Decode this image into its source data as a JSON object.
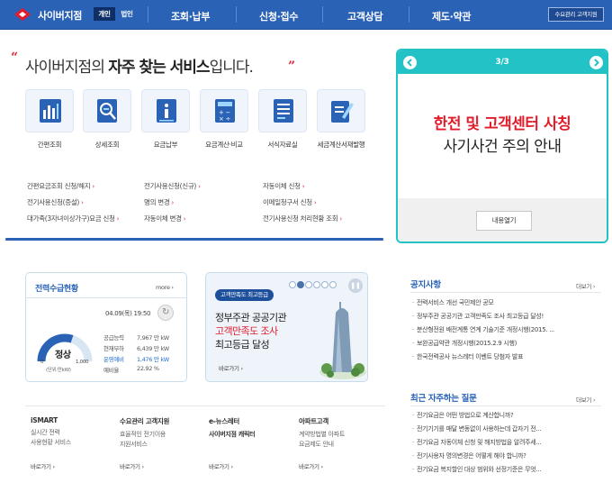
{
  "header": {
    "brand": "사이버지점",
    "segments": [
      "개인",
      "법인"
    ],
    "nav": [
      "조회·납부",
      "신청·접수",
      "고객상담",
      "제도·약관"
    ],
    "demand_button": "수요관리 고객지원"
  },
  "hero": {
    "prefix": "사이버지점의 ",
    "bold": "자주 찾는 서비스",
    "suffix": "입니다."
  },
  "services": [
    {
      "label": "간편조회",
      "icon": "bar-chart-icon"
    },
    {
      "label": "상세조회",
      "icon": "magnify-document-icon"
    },
    {
      "label": "요금납부",
      "icon": "info-card-icon"
    },
    {
      "label": "요금계산·비교",
      "icon": "calculator-icon"
    },
    {
      "label": "서식자료실",
      "icon": "form-list-icon"
    },
    {
      "label": "세금계산서재발행",
      "icon": "pencil-document-icon"
    }
  ],
  "quick_links": [
    [
      "간편요금조회 신청/해지",
      "전기사용신청(신규)",
      "자동이체 신청"
    ],
    [
      "전기사용신청(증설)",
      "명의 변경",
      "이메일청구서 신청"
    ],
    [
      "대가족(3자녀이상가구)요금 신청",
      "자동이체 변경",
      "전기사용신청 처리현황 조회"
    ]
  ],
  "notice": {
    "page": "3/3",
    "line1": "한전 및 고객센터 사칭",
    "line2": "사기사건 주의 안내",
    "button": "내용열기"
  },
  "power": {
    "title": "전력수급현황",
    "more": "more",
    "datetime": "04.09(목) 19:50",
    "state": "정상",
    "scale_min": "0",
    "scale_max": "1,000",
    "unit": "(단위:만kW)",
    "gauge_fraction": 0.6,
    "stats": [
      {
        "k": "공급능력",
        "v": "7,967 만 kW",
        "hl": false
      },
      {
        "k": "현재부하",
        "v": "6,439 만 kW",
        "hl": false
      },
      {
        "k": "운영예비",
        "v": "1,476 만 kW",
        "hl": true
      },
      {
        "k": "예비율",
        "v": "22.92 %",
        "hl": false
      }
    ]
  },
  "promo": {
    "badge": "고객만족도 최고등급",
    "line1": "정부주관 공공기관",
    "line2": "고객만족도 조사",
    "line3": "최고등급 달성",
    "more": "바로가기",
    "dots_total": 6,
    "dots_active": 1
  },
  "announcements": {
    "title": "공지사항",
    "more": "더보기",
    "items": [
      "전력서비스 개선 국민제안 공모",
      "정부주관 공공기관 고객만족도 조사 최고등급 달성!",
      "분산형전원 배전계통 연계 기술기준 개정시행(2015. ...",
      "보완공급약관 개정시행(2015.2.9 시행)",
      "한국전력공사 뉴스레터 이벤트 당첨자 발표"
    ]
  },
  "faq": {
    "title": "최근 자주하는 질문",
    "more": "더보기",
    "items": [
      "전기요금은 어떤 방법으로 계산합니까?",
      "전기기기를 매달 변동없이 사용하는데 갑자기 전...",
      "전기요금 자동이체 신청 및 해지방법을 알려주세...",
      "전기사용자 명의변경은 어떻게 해야 합니까?",
      "전기요금 복지할인 대상 범위와 선정기준은 무엇..."
    ]
  },
  "bottom": [
    {
      "title": "iSMART",
      "desc": "실시간 전력\n사용현황 서비스",
      "more": "바로가기",
      "bold": false
    },
    {
      "title": "수요관리 고객지원",
      "desc": "효율적인 전기이용\n지원서비스",
      "more": "바로가기",
      "bold": false
    },
    {
      "title": "e-뉴스레터",
      "desc": "사이버지점 캐릭터",
      "more": "바로가기",
      "bold": true
    },
    {
      "title": "아파트고객",
      "desc": "계약방법별 아파트\n요금제도 안내",
      "more": "바로가기",
      "bold": false
    }
  ],
  "colors": {
    "brand": "#2a62b6",
    "accent": "#e21c2b",
    "teal": "#23c2c7"
  }
}
